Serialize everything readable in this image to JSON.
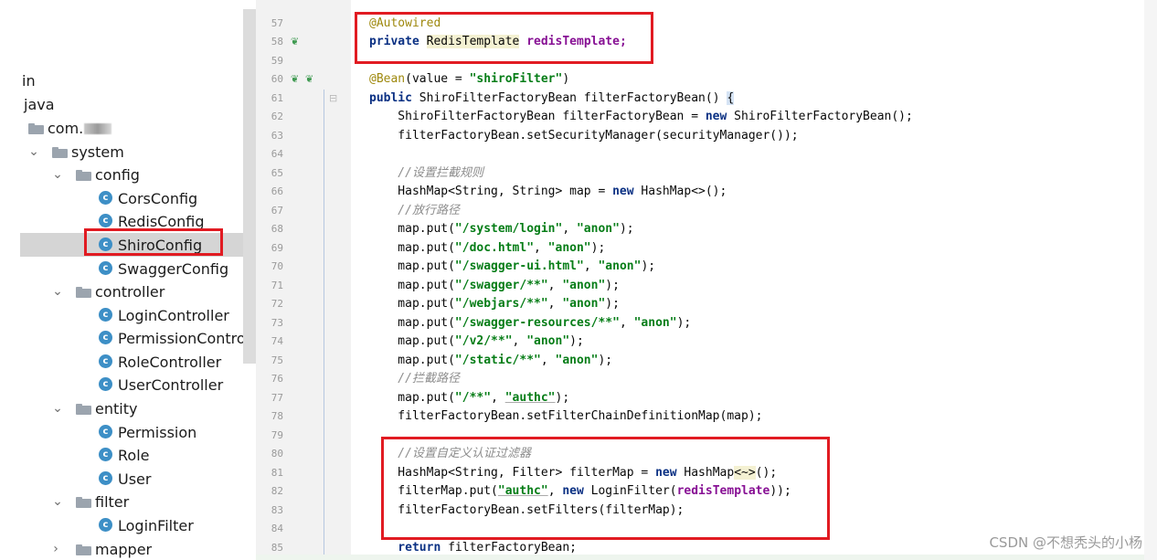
{
  "project_tree": {
    "items": [
      {
        "label": "in",
        "kind": "plain"
      },
      {
        "label": "java",
        "kind": "plain"
      },
      {
        "label": "com.",
        "kind": "package"
      },
      {
        "label": "system",
        "kind": "folder",
        "arrow": "chevron-down-icon"
      },
      {
        "label": "config",
        "kind": "folder",
        "arrow": "chevron-down-icon"
      },
      {
        "label": "CorsConfig",
        "kind": "class"
      },
      {
        "label": "RedisConfig",
        "kind": "class"
      },
      {
        "label": "ShiroConfig",
        "kind": "class",
        "selected": true
      },
      {
        "label": "SwaggerConfig",
        "kind": "class"
      },
      {
        "label": "controller",
        "kind": "folder",
        "arrow": "chevron-down-icon"
      },
      {
        "label": "LoginController",
        "kind": "class"
      },
      {
        "label": "PermissionControlle",
        "kind": "class"
      },
      {
        "label": "RoleController",
        "kind": "class"
      },
      {
        "label": "UserController",
        "kind": "class"
      },
      {
        "label": "entity",
        "kind": "folder",
        "arrow": "chevron-down-icon"
      },
      {
        "label": "Permission",
        "kind": "class"
      },
      {
        "label": "Role",
        "kind": "class"
      },
      {
        "label": "User",
        "kind": "class"
      },
      {
        "label": "filter",
        "kind": "folder",
        "arrow": "chevron-down-icon"
      },
      {
        "label": "LoginFilter",
        "kind": "class"
      },
      {
        "label": "mapper",
        "kind": "folder",
        "arrow": "chevron-right-icon"
      }
    ],
    "class_badge": "c"
  },
  "gutter": {
    "line_numbers": [
      "57",
      "58",
      "59",
      "60",
      "61",
      "62",
      "63",
      "64",
      "65",
      "66",
      "67",
      "68",
      "69",
      "70",
      "71",
      "72",
      "73",
      "74",
      "75",
      "76",
      "77",
      "78",
      "79",
      "80",
      "81",
      "82",
      "83",
      "84",
      "85"
    ]
  },
  "code": {
    "l57": {
      "ann": "@Autowired"
    },
    "l58": {
      "kw": "private",
      "type": "RedisTemplate",
      "var": "redisTemplate;"
    },
    "l60": {
      "ann": "@Bean",
      "open": "(value = ",
      "str": "\"shiroFilter\"",
      "close": ")"
    },
    "l61": {
      "kw": "public",
      "text": "ShiroFilterFactoryBean filterFactoryBean() ",
      "brace": "{"
    },
    "l62": {
      "a": "    ShiroFilterFactoryBean filterFactoryBean = ",
      "kw": "new",
      "b": " ShiroFilterFactoryBean();"
    },
    "l63": {
      "text": "    filterFactoryBean.setSecurityManager(securityManager());"
    },
    "l65": {
      "cmt": "    //设置拦截规则"
    },
    "l66": {
      "a": "    HashMap<String, String> map = ",
      "kw": "new",
      "b": " HashMap<>();"
    },
    "l67": {
      "cmt": "    //放行路径"
    },
    "puts": [
      {
        "path": "\"/system/login\"",
        "val": "\"anon\""
      },
      {
        "path": "\"/doc.html\"",
        "val": "\"anon\""
      },
      {
        "path": "\"/swagger-ui.html\"",
        "val": "\"anon\""
      },
      {
        "path": "\"/swagger/**\"",
        "val": "\"anon\""
      },
      {
        "path": "\"/webjars/**\"",
        "val": "\"anon\""
      },
      {
        "path": "\"/swagger-resources/**\"",
        "val": "\"anon\""
      },
      {
        "path": "\"/v2/**\"",
        "val": "\"anon\""
      },
      {
        "path": "\"/static/**\"",
        "val": "\"anon\""
      }
    ],
    "put_prefix": "    map.put(",
    "put_sep": ", ",
    "put_end": ");",
    "l76": {
      "cmt": "    //拦截路径"
    },
    "l77": {
      "path": "\"/**\"",
      "val": "\"authc\""
    },
    "l78": {
      "text": "    filterFactoryBean.setFilterChainDefinitionMap(map);"
    },
    "l80": {
      "cmt": "    //设置自定义认证过滤器"
    },
    "l81": {
      "a": "    HashMap<String, Filter> filterMap = ",
      "kw": "new",
      "b": " HashMap",
      "diamond": "<~>",
      "c": "();"
    },
    "l82": {
      "a": "    filterMap.put(",
      "str": "\"authc\"",
      "b": ", ",
      "kw": "new",
      "c": " LoginFilter(",
      "field": "redisTemplate",
      "d": "));"
    },
    "l83": {
      "text": "    filterFactoryBean.setFilters(filterMap);"
    },
    "l85": {
      "kw": "    return",
      "text": " filterFactoryBean;"
    }
  },
  "watermark": "CSDN @不想秃头的小杨",
  "colors": {
    "highlight_box": "#e11b22",
    "selection": "#d5d5d5",
    "keyword": "#0a3083",
    "string": "#067d17",
    "comment": "#8c8c8c",
    "annotation": "#9e880d"
  }
}
